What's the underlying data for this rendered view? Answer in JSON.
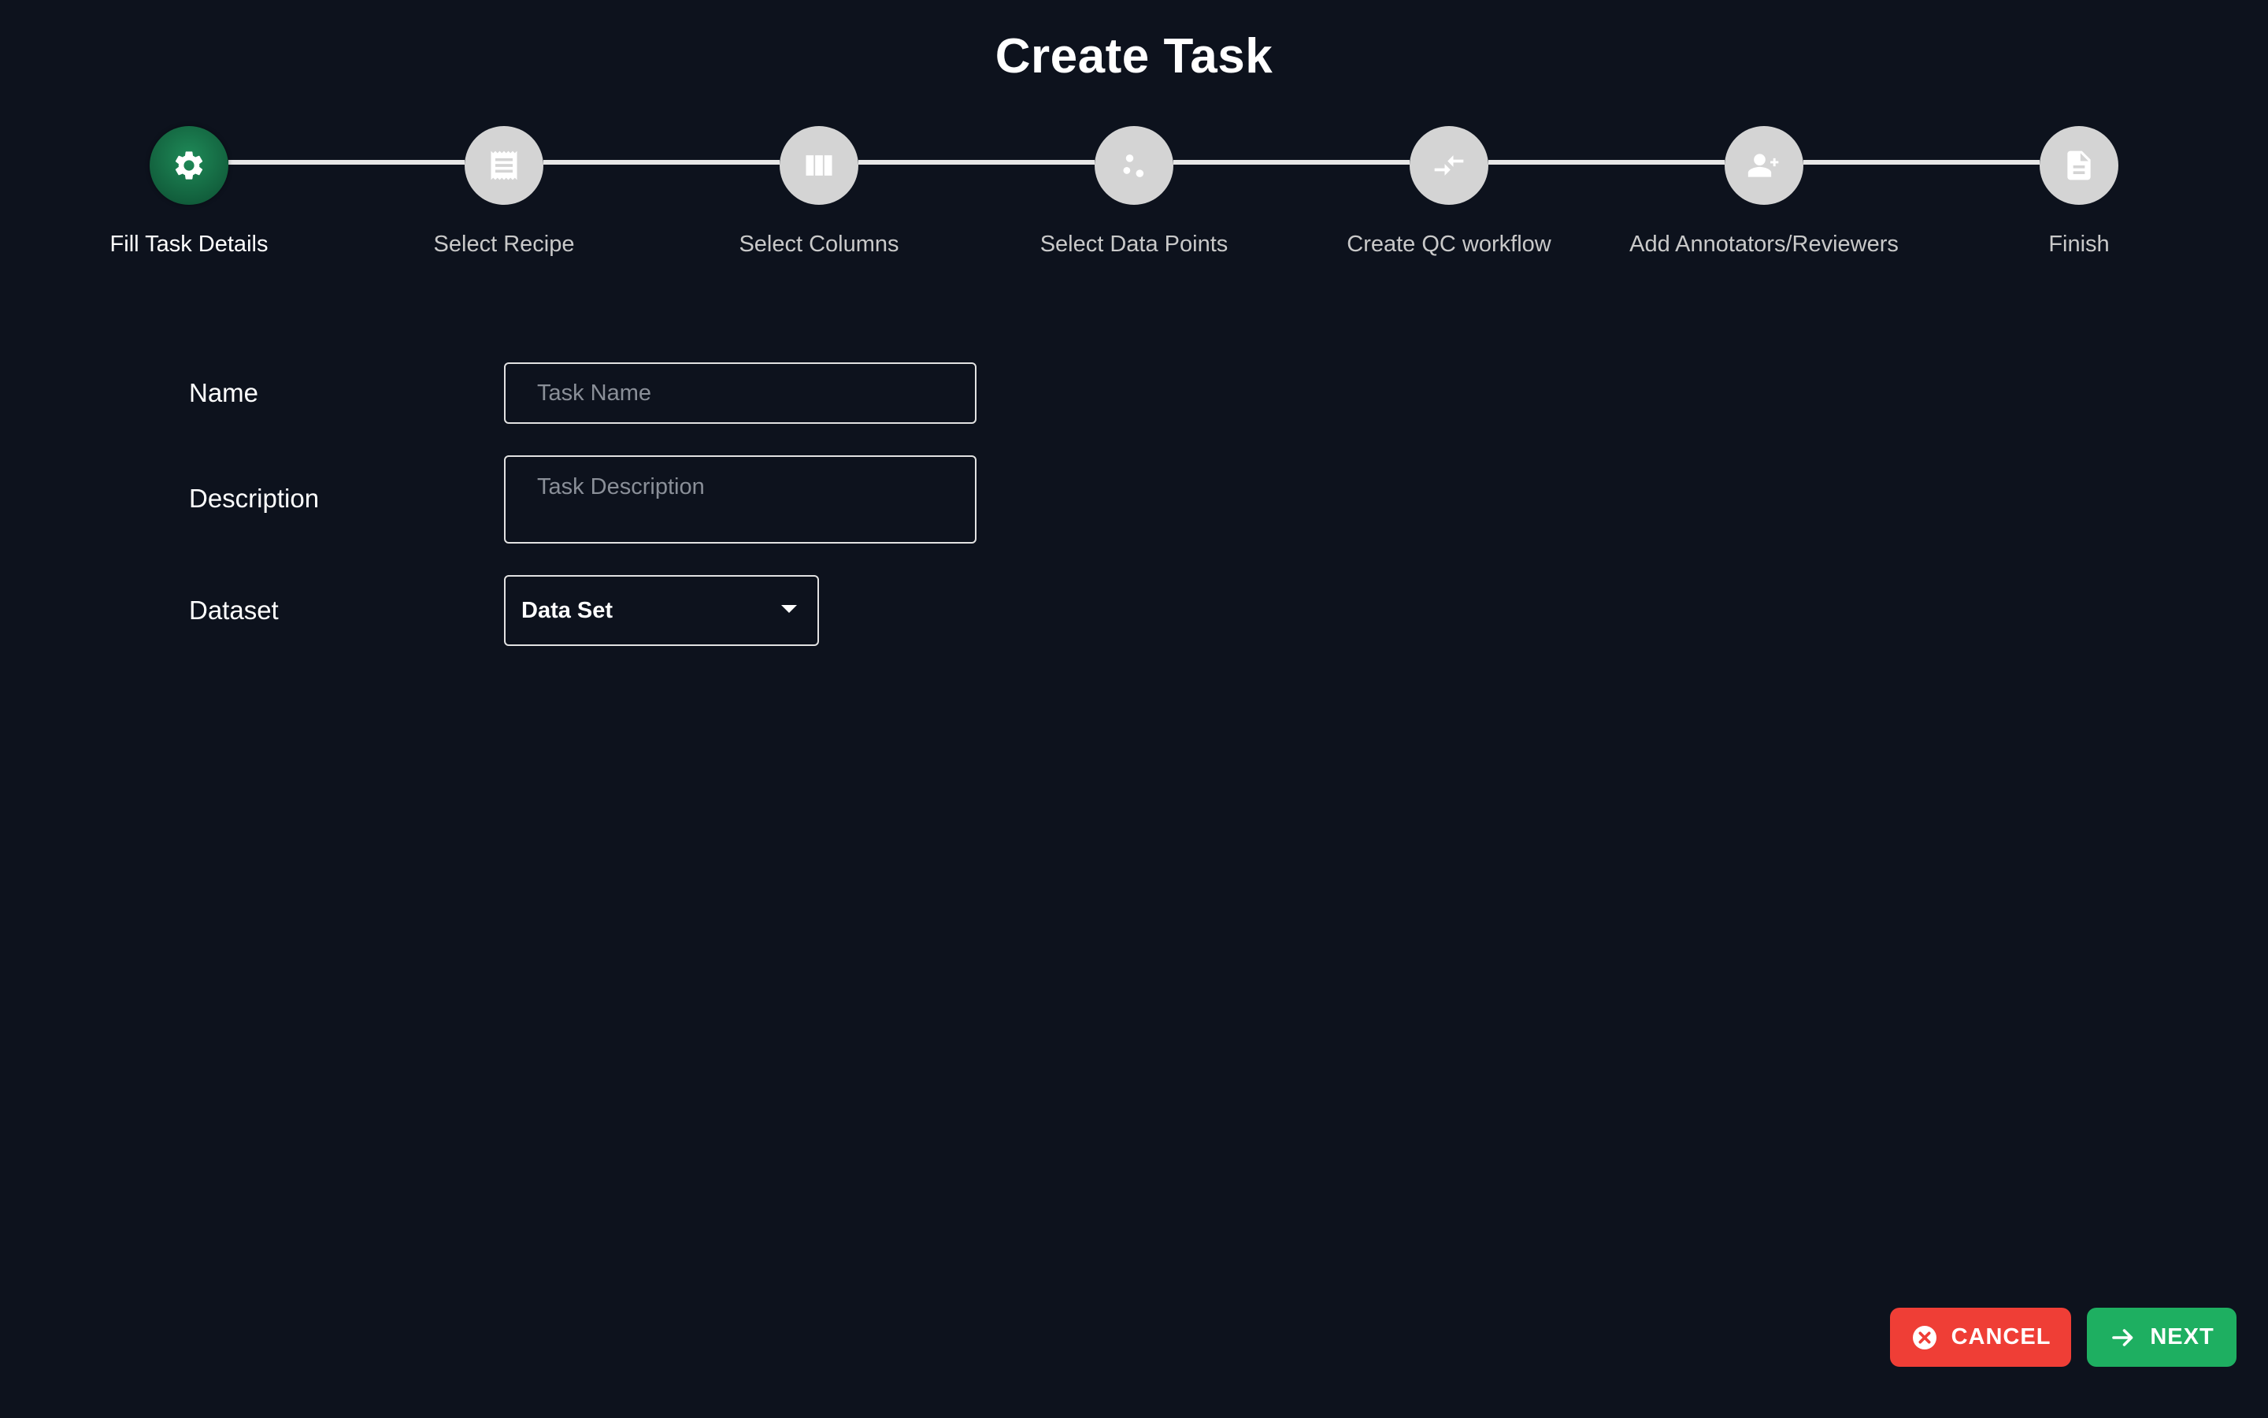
{
  "page": {
    "title": "Create Task"
  },
  "stepper": {
    "active_index": 0,
    "steps": [
      {
        "label": "Fill Task Details",
        "icon": "gear-icon",
        "state": "active"
      },
      {
        "label": "Select Recipe",
        "icon": "recipe-icon",
        "state": "pending"
      },
      {
        "label": "Select Columns",
        "icon": "columns-icon",
        "state": "pending"
      },
      {
        "label": "Select Data Points",
        "icon": "scatter-points-icon",
        "state": "pending"
      },
      {
        "label": "Create QC workflow",
        "icon": "compare-arrows-icon",
        "state": "pending"
      },
      {
        "label": "Add Annotators/Reviewers",
        "icon": "group-add-icon",
        "state": "pending"
      },
      {
        "label": "Finish",
        "icon": "document-icon",
        "state": "pending"
      }
    ]
  },
  "form": {
    "name": {
      "label": "Name",
      "placeholder": "Task Name",
      "value": ""
    },
    "description": {
      "label": "Description",
      "placeholder": "Task Description",
      "value": ""
    },
    "dataset": {
      "label": "Dataset",
      "selected": "Data Set"
    }
  },
  "actions": {
    "cancel_label": "CANCEL",
    "next_label": "NEXT"
  },
  "colors": {
    "background": "#0d121d",
    "active_step": "#12603d",
    "inactive_step": "#d4d4d4",
    "cancel": "#ef3e36",
    "next": "#1eaf61"
  }
}
